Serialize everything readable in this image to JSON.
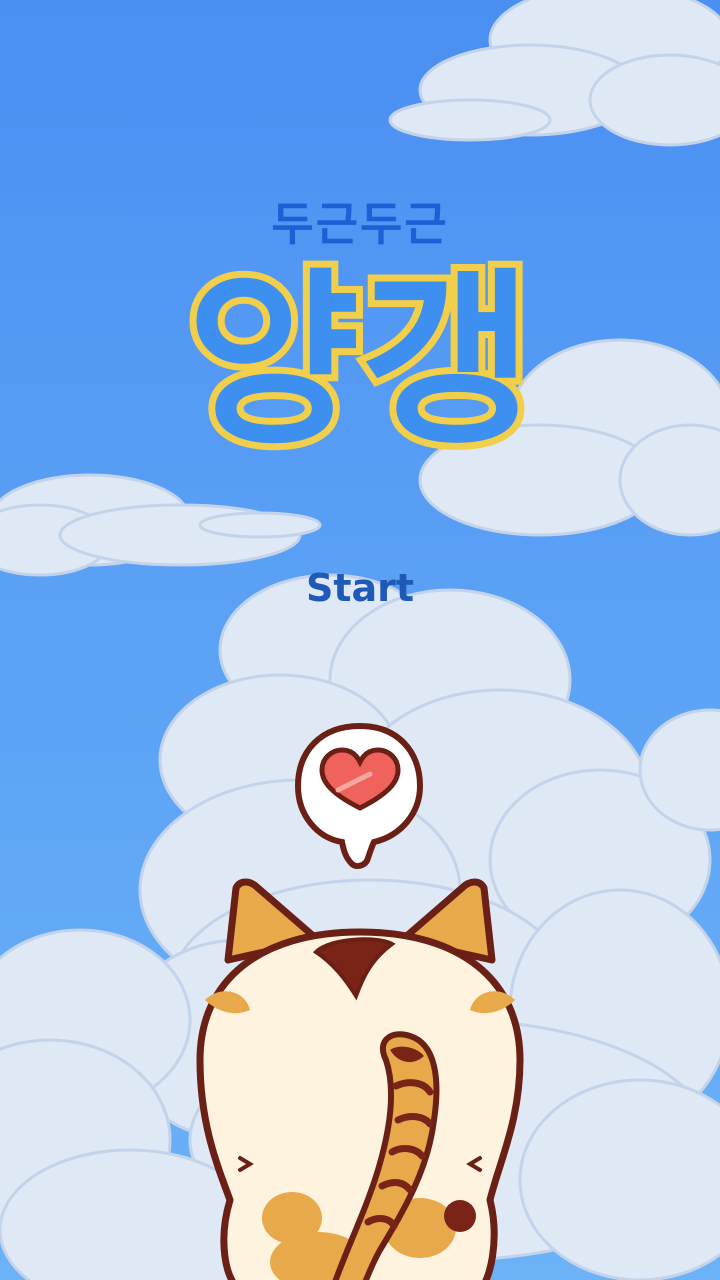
{
  "title": {
    "subtitle": "두근두근",
    "main": "양갱"
  },
  "menu": {
    "start_label": "Start"
  },
  "scene": {
    "icons": [
      "heart-speech-bubble-icon",
      "cat-character"
    ],
    "colors": {
      "sky": "#4a8ff2",
      "title_fill": "#3d8ff0",
      "title_outline": "#f2cf4a",
      "subtitle": "#1e5fd6",
      "start_text": "#1f5ab8",
      "cat_fur": "#fdf3df",
      "cat_patch": "#e8a94a",
      "cat_dark": "#7a2418",
      "heart": "#f0625c"
    }
  }
}
